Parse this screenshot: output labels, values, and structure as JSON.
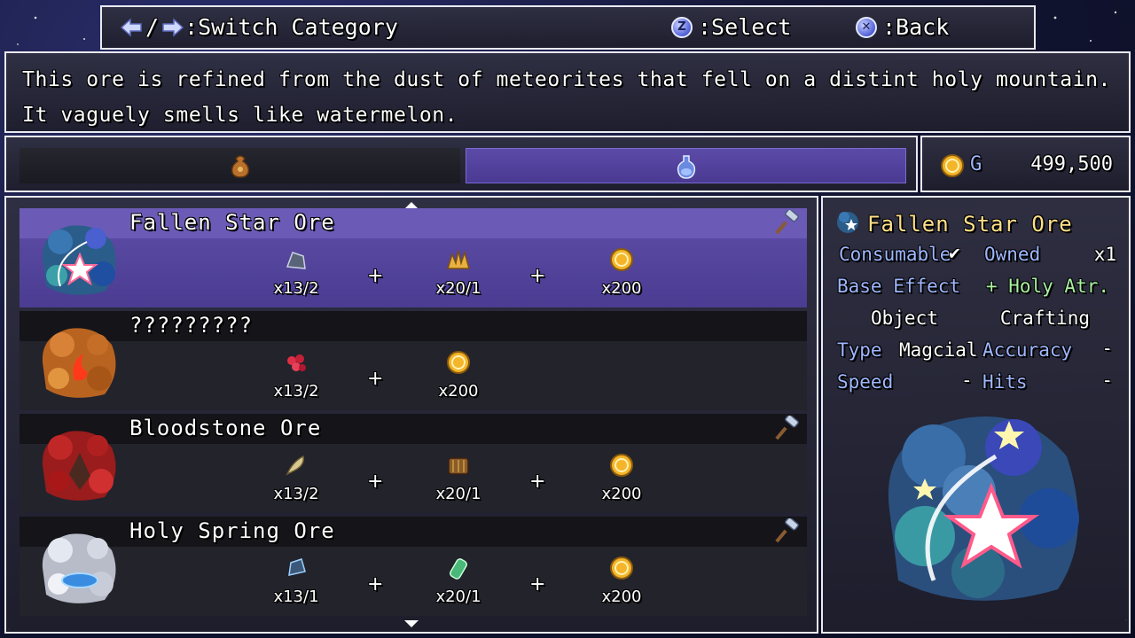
{
  "help_bar": {
    "switch_separator": "/",
    "switch_label": ":Switch Category",
    "select_key": "Z",
    "select_label": ":Select",
    "back_key": "✕",
    "back_label": ":Back"
  },
  "description": "This ore is refined from the dust of meteorites that fell on a distint holy mountain. It vaguely smells like watermelon.",
  "tabs": [
    {
      "name": "materials",
      "icon": "pouch-icon",
      "selected": false
    },
    {
      "name": "crafted",
      "icon": "potion-icon",
      "selected": true
    }
  ],
  "gold": {
    "unit": "G",
    "amount": "499,500"
  },
  "recipes": [
    {
      "name": "Fallen Star Ore",
      "selected": true,
      "craftable": true,
      "ingredients": [
        {
          "icon": "dark-shard-icon",
          "qty": "x13/2"
        },
        {
          "icon": "gold-crystal-icon",
          "qty": "x20/1"
        },
        {
          "icon": "gold-coin-icon",
          "qty": "x200"
        }
      ]
    },
    {
      "name": "?????????",
      "selected": false,
      "craftable": false,
      "ingredients": [
        {
          "icon": "red-berries-icon",
          "qty": "x13/2"
        },
        {
          "icon": "gold-coin-icon",
          "qty": "x200"
        }
      ]
    },
    {
      "name": "Bloodstone Ore",
      "selected": false,
      "craftable": true,
      "ingredients": [
        {
          "icon": "feather-icon",
          "qty": "x13/2"
        },
        {
          "icon": "bark-icon",
          "qty": "x20/1"
        },
        {
          "icon": "gold-coin-icon",
          "qty": "x200"
        }
      ]
    },
    {
      "name": "Holy Spring Ore",
      "selected": false,
      "craftable": true,
      "ingredients": [
        {
          "icon": "blue-crystal-icon",
          "qty": "x13/1"
        },
        {
          "icon": "green-vial-icon",
          "qty": "x20/1"
        },
        {
          "icon": "gold-coin-icon",
          "qty": "x200"
        }
      ]
    }
  ],
  "detail": {
    "title": "Fallen Star Ore",
    "consumable_label": "Consumable",
    "consumable_check": "✔",
    "owned_label": "Owned",
    "owned_value": "x1",
    "base_effect_label": "Base Effect",
    "base_effect_value": "+ Holy Atr.",
    "object_label": "Object",
    "object_value": "Crafting",
    "type_label": "Type",
    "type_value": "Magcial",
    "accuracy_label": "Accuracy",
    "accuracy_value": "-",
    "speed_label": "Speed",
    "speed_value": "-",
    "hits_label": "Hits",
    "hits_value": "-"
  }
}
